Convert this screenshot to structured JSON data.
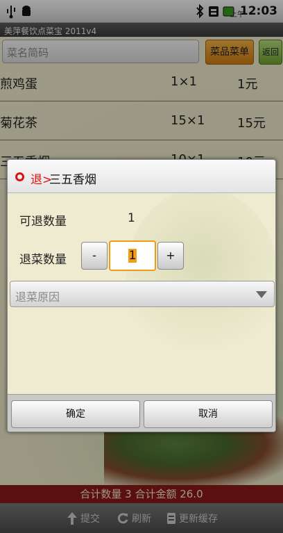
{
  "status_bar": {
    "time": "12:03",
    "ampm": "上午"
  },
  "app_title": "美萍餐饮点菜宝 2011v4",
  "search": {
    "placeholder": "菜名简码"
  },
  "toolbar": {
    "menu_label": "菜品菜单",
    "back_label": "返回"
  },
  "orders": [
    {
      "name": "煎鸡蛋",
      "qty": "1×1",
      "amount": "1元"
    },
    {
      "name": "菊花茶",
      "qty": "15×1",
      "amount": "15元"
    },
    {
      "name": "三五香烟",
      "qty": "10×1",
      "amount": "10元"
    }
  ],
  "totals": {
    "text": "合计数量  3  合计金额  26.0"
  },
  "bottom_bar": {
    "submit": "提交",
    "refresh": "刷新",
    "update_cache": "更新缓存"
  },
  "dialog": {
    "tag": "退>",
    "title": "三五香烟",
    "returnable_label": "可退数量",
    "returnable_value": "1",
    "return_qty_label": "退菜数量",
    "minus": "-",
    "plus": "+",
    "return_qty_value": "1",
    "reason_placeholder": "退菜原因",
    "ok_label": "确定",
    "cancel_label": "取消"
  },
  "colors": {
    "accent_orange": "#f29b12",
    "brand_red": "#8b1a17",
    "back_green": "#6fa42f"
  }
}
